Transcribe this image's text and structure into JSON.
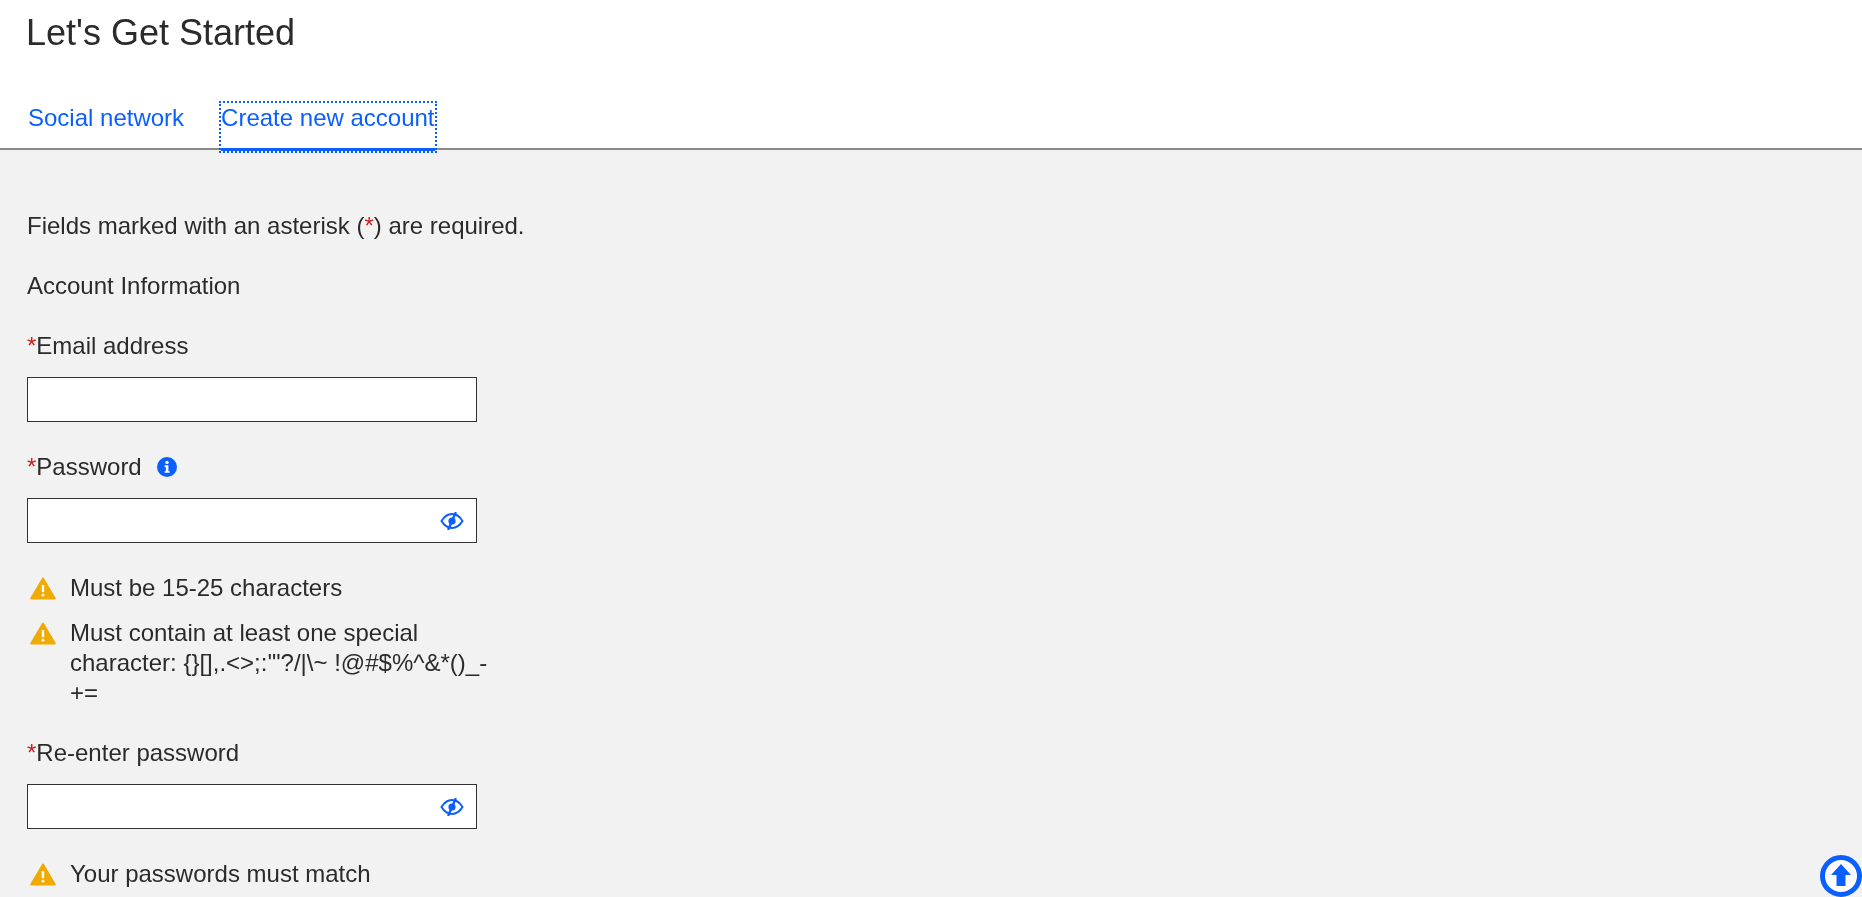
{
  "page": {
    "title": "Let's Get Started"
  },
  "tabs": [
    {
      "label": "Social network",
      "selected": false,
      "focused": false
    },
    {
      "label": "Create new account",
      "selected": true,
      "focused": true
    }
  ],
  "form": {
    "required_note": {
      "before": "Fields marked with an asterisk (",
      "marker": "*",
      "after": ") are required."
    },
    "section_title": "Account Information",
    "fields": [
      {
        "kind": "email",
        "marker": "*",
        "label": "Email address",
        "info": false
      },
      {
        "kind": "password",
        "marker": "*",
        "label": "Password",
        "info": true,
        "hints": [
          {
            "kind": "warning",
            "text": "Must be 15-25 characters"
          },
          {
            "kind": "warning",
            "text": "Must contain at least one special character: {}[],.<>;:'\"?/|\\~ !@#$%^&*()_-+="
          }
        ]
      },
      {
        "kind": "password",
        "marker": "*",
        "label": "Re-enter password",
        "info": false,
        "hints": [
          {
            "kind": "warning",
            "text": "Your passwords must match"
          }
        ]
      }
    ]
  }
}
